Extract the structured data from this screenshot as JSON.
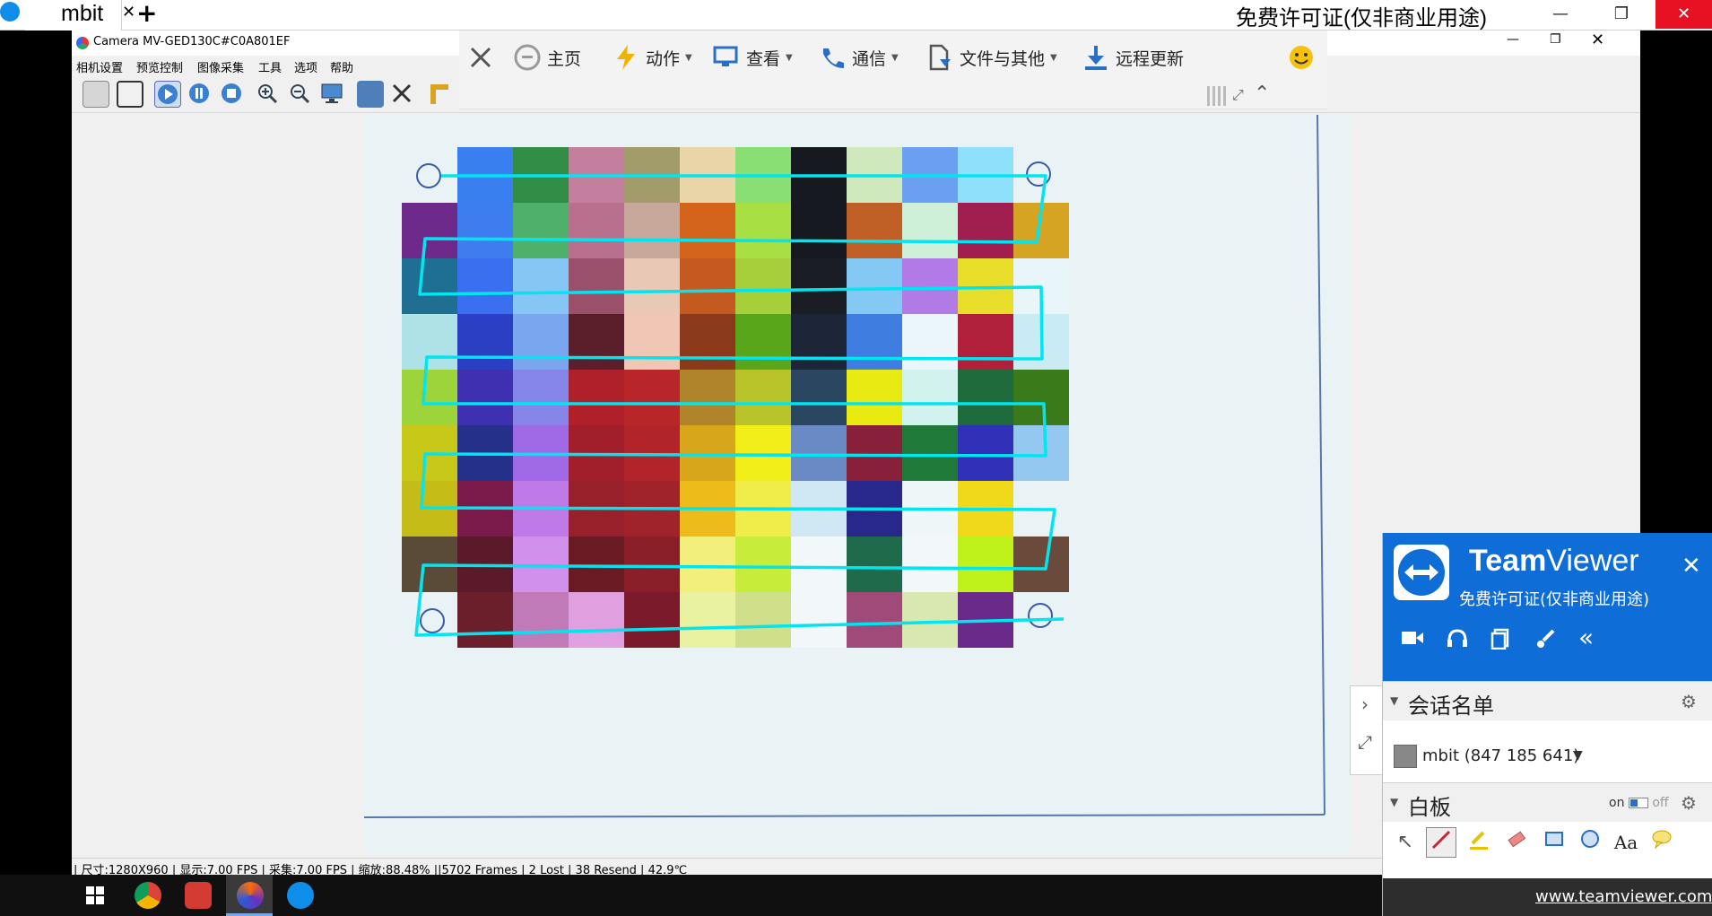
{
  "outer": {
    "tab_label": "mbit",
    "tab_close": "✕",
    "tab_add": "+",
    "license": "免费许可证(仅非商业用途)",
    "min": "—",
    "max": "❐",
    "close": "✕"
  },
  "camera_app": {
    "title": "Camera MV-GED130C#C0A801EF",
    "menu": [
      "相机设置",
      "预览控制",
      "图像采集",
      "工具",
      "选项",
      "帮助"
    ],
    "status": "| 尺寸:1280X960 | 显示:7.00 FPS | 采集:7.00 FPS | 缩放:88.48% ||5702 Frames | 2 Lost | 38 Resend | 42.9℃"
  },
  "tv_toolbar": {
    "home": "主页",
    "actions": "动作",
    "view": "查看",
    "communicate": "通信",
    "files": "文件与其他",
    "remote_update": "远程更新"
  },
  "tv_panel": {
    "brand_bold": "Team",
    "brand_light": "Viewer",
    "subtitle": "免费许可证(仅非商业用途)",
    "close": "✕",
    "session_list_title": "会话名单",
    "session_name": "mbit (847 185 641)",
    "whiteboard_title": "白板",
    "on_label": "on",
    "off_label": "off",
    "url": "www.teamviewer.com"
  },
  "icons": {
    "colors": {
      "tv_blue": "#0e6dd6",
      "accent_red": "#e81123",
      "stroke_cyan": "#00e5f0"
    }
  }
}
